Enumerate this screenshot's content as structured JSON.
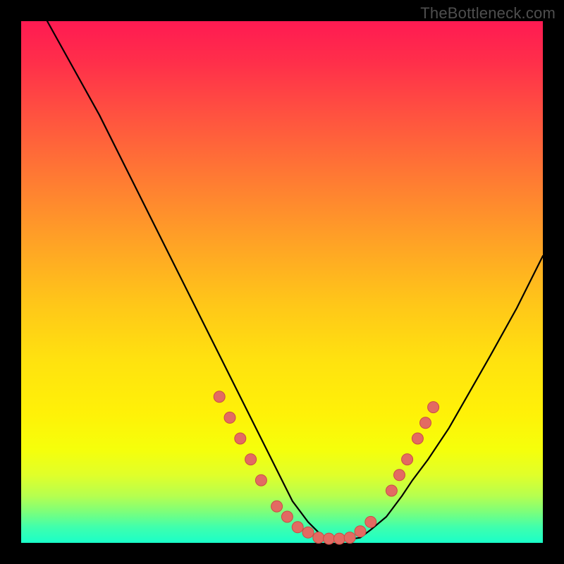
{
  "watermark": "TheBottleneck.com",
  "colors": {
    "background": "#000000",
    "gradient_top": "#ff1a52",
    "gradient_bottom": "#1affc9",
    "curve": "#000000",
    "marker_fill": "#e36a62",
    "marker_stroke": "#c94d45"
  },
  "chart_data": {
    "type": "line",
    "title": "",
    "subtitle": "",
    "xlabel": "",
    "ylabel": "",
    "xlim": [
      0,
      100
    ],
    "ylim": [
      0,
      100
    ],
    "grid": false,
    "legend": false,
    "series": [
      {
        "name": "bottleneck-curve",
        "x": [
          5,
          10,
          15,
          20,
          25,
          30,
          35,
          40,
          45,
          48,
          50,
          52,
          55,
          57,
          58,
          60,
          62,
          65,
          67,
          70,
          73,
          75,
          78,
          82,
          86,
          90,
          95,
          100
        ],
        "y": [
          100,
          91,
          82,
          72,
          62,
          52,
          42,
          32,
          22,
          16,
          12,
          8,
          4,
          2,
          1,
          0.5,
          0.5,
          1,
          2.5,
          5,
          9,
          12,
          16,
          22,
          29,
          36,
          45,
          55
        ]
      }
    ],
    "markers": [
      {
        "x": 38,
        "y": 28
      },
      {
        "x": 40,
        "y": 24
      },
      {
        "x": 42,
        "y": 20
      },
      {
        "x": 44,
        "y": 16
      },
      {
        "x": 46,
        "y": 12
      },
      {
        "x": 49,
        "y": 7
      },
      {
        "x": 51,
        "y": 5
      },
      {
        "x": 53,
        "y": 3
      },
      {
        "x": 55,
        "y": 2
      },
      {
        "x": 57,
        "y": 1
      },
      {
        "x": 59,
        "y": 0.8
      },
      {
        "x": 61,
        "y": 0.8
      },
      {
        "x": 63,
        "y": 1
      },
      {
        "x": 65,
        "y": 2.2
      },
      {
        "x": 67,
        "y": 4
      },
      {
        "x": 71,
        "y": 10
      },
      {
        "x": 72.5,
        "y": 13
      },
      {
        "x": 74,
        "y": 16
      },
      {
        "x": 76,
        "y": 20
      },
      {
        "x": 77.5,
        "y": 23
      },
      {
        "x": 79,
        "y": 26
      }
    ]
  }
}
